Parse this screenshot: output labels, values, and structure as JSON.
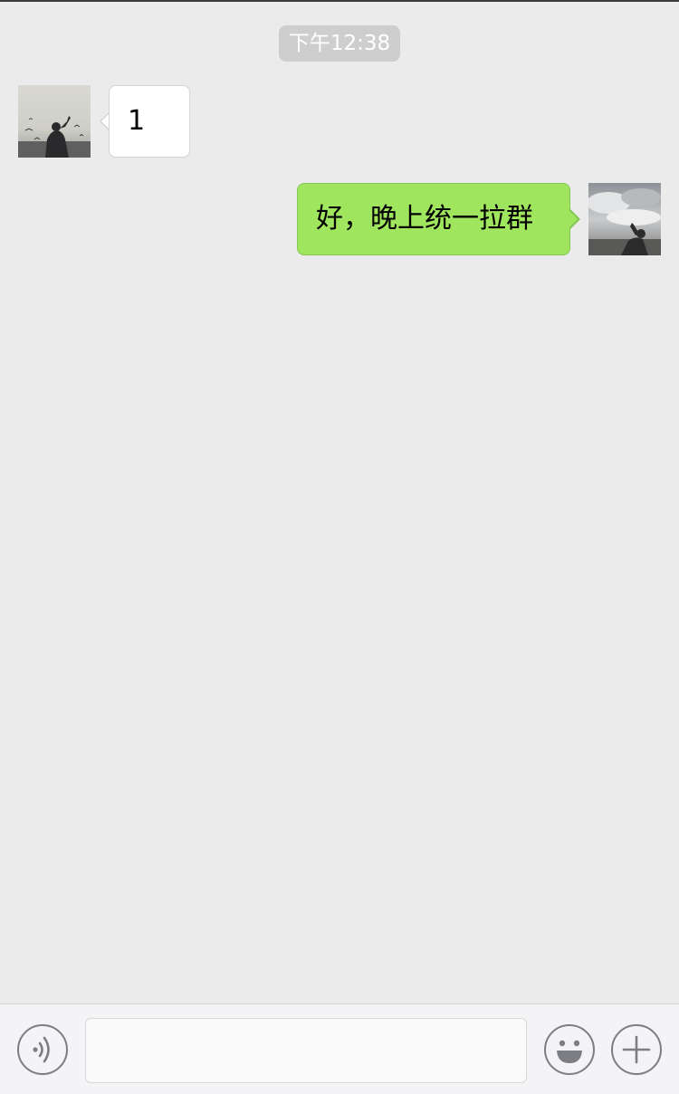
{
  "chat": {
    "timestamp": "下午12:38",
    "messages": [
      {
        "direction": "incoming",
        "text": "1",
        "avatar": "seagull-silhouette-avatar"
      },
      {
        "direction": "outgoing",
        "text": "好，晚上统一拉群",
        "avatar": "cloudy-sky-silhouette-avatar"
      }
    ]
  },
  "input_bar": {
    "voice_icon": "voice-wave-icon",
    "message_value": "",
    "emoji_icon": "smiley-icon",
    "more_icon": "plus-icon"
  },
  "colors": {
    "background": "#ebebeb",
    "incoming_bubble": "#ffffff",
    "outgoing_bubble": "#9fe55e",
    "timestamp_pill": "#cecece",
    "icon_stroke": "#7d7e83"
  }
}
